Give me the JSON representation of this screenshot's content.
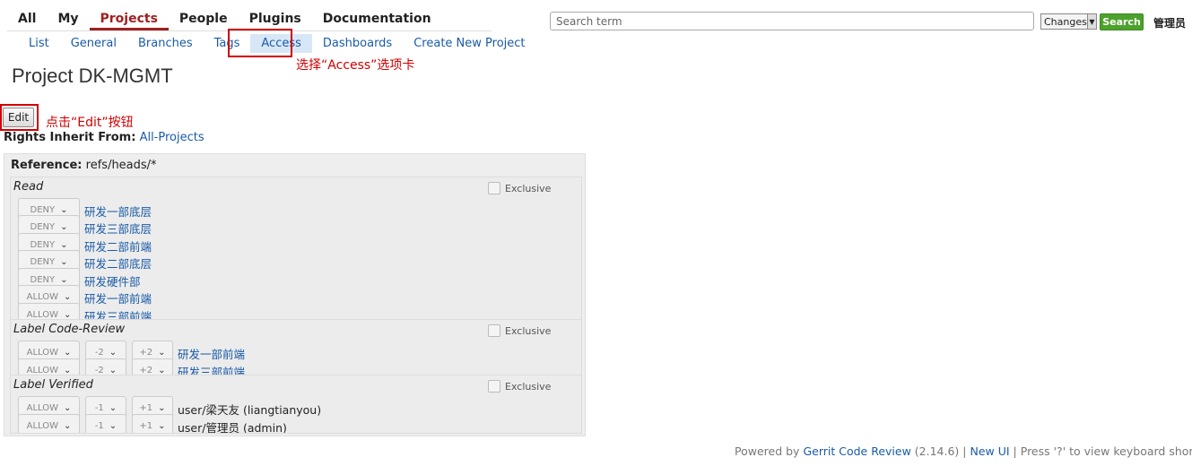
{
  "top_menu": [
    "All",
    "My",
    "Projects",
    "People",
    "Plugins",
    "Documentation"
  ],
  "sub_menu": [
    "List",
    "General",
    "Branches",
    "Tags",
    "Access",
    "Dashboards",
    "Create New Project"
  ],
  "search": {
    "placeholder": "Search term",
    "type": "Changes",
    "button": "Search"
  },
  "user": "管理员",
  "annotations": {
    "access_tab": "选择“Access”选项卡",
    "edit_button": "点击“Edit”按钮"
  },
  "page_title": "Project DK-MGMT",
  "edit_label": "Edit",
  "inherit": {
    "label": "Rights Inherit From:",
    "project": "All-Projects"
  },
  "reference": {
    "label": "Reference:",
    "value": "refs/heads/*"
  },
  "exclusive_label": "Exclusive",
  "permissions": {
    "read": {
      "name": "Read",
      "rules": [
        {
          "action": "DENY",
          "group": "研发一部底层"
        },
        {
          "action": "DENY",
          "group": "研发三部底层"
        },
        {
          "action": "DENY",
          "group": "研发二部前端"
        },
        {
          "action": "DENY",
          "group": "研发二部底层"
        },
        {
          "action": "DENY",
          "group": "研发硬件部"
        },
        {
          "action": "ALLOW",
          "group": "研发一部前端"
        },
        {
          "action": "ALLOW",
          "group": "研发三部前端"
        }
      ]
    },
    "code_review": {
      "name": "Label Code-Review",
      "rules": [
        {
          "action": "ALLOW",
          "min": "-2",
          "max": "+2",
          "group": "研发一部前端"
        },
        {
          "action": "ALLOW",
          "min": "-2",
          "max": "+2",
          "group": "研发三部前端"
        }
      ]
    },
    "verified": {
      "name": "Label Verified",
      "rules": [
        {
          "action": "ALLOW",
          "min": "-1",
          "max": "+1",
          "group": "user/梁天友 (liangtianyou)"
        },
        {
          "action": "ALLOW",
          "min": "-1",
          "max": "+1",
          "group": "user/管理员 (admin)"
        }
      ]
    }
  },
  "footer": {
    "powered_by": "Powered by",
    "product": "Gerrit Code Review",
    "version": "(2.14.6)",
    "sep1": "|",
    "new_ui": "New UI",
    "sep2": "|",
    "shortcut_text": "Press '?' to view keyboard shortcuts"
  },
  "colors": {
    "selected_tab": "#a02020",
    "link": "#1a5ba6",
    "search_button": "#4da22c",
    "annotation": "#d00000"
  }
}
